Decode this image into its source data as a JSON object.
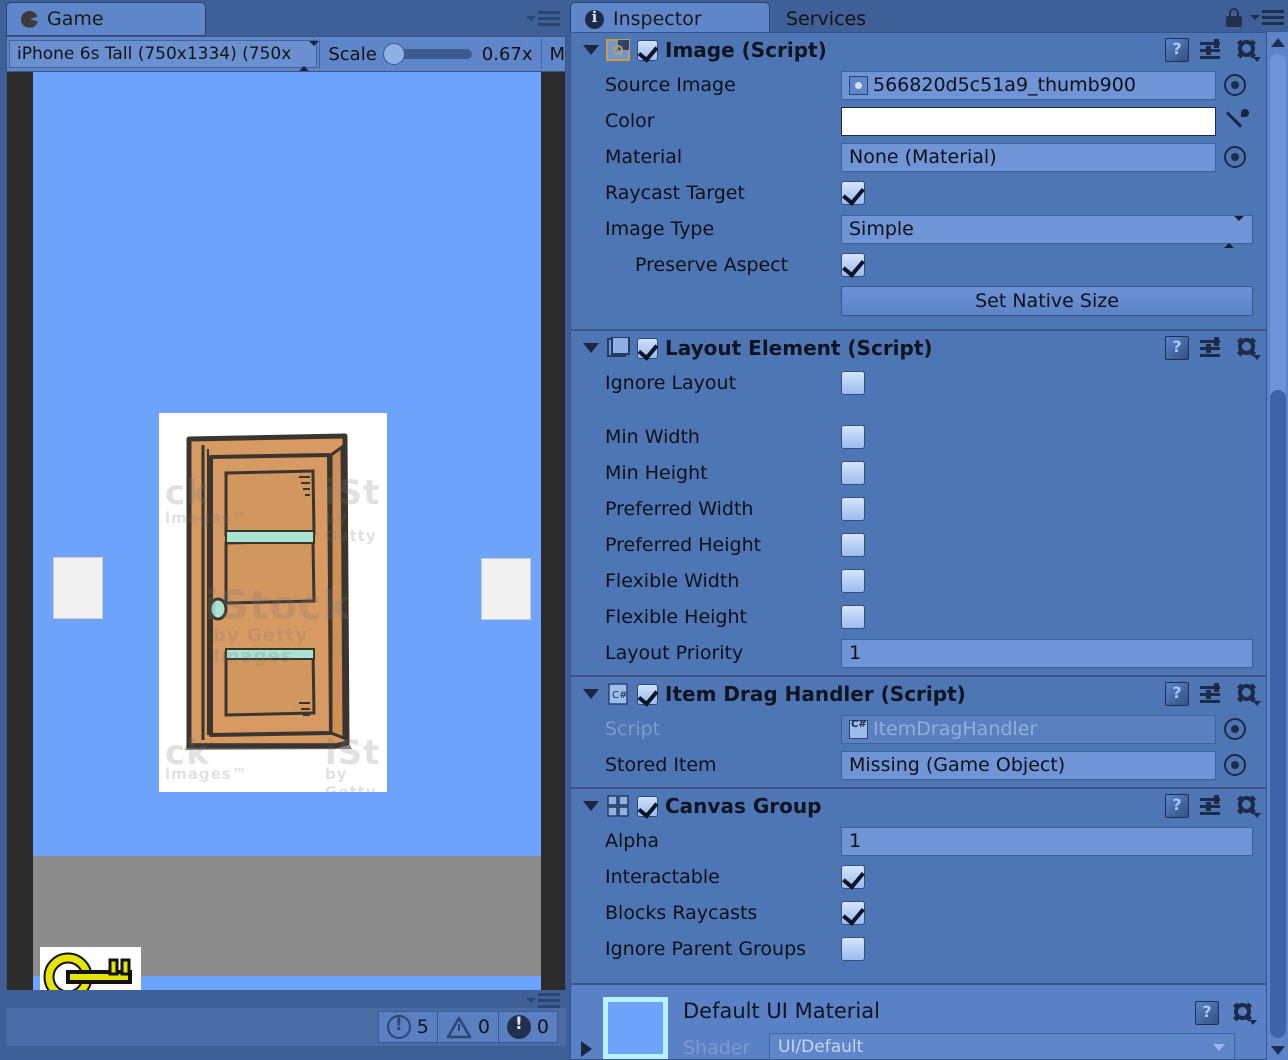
{
  "game": {
    "tab_label": "Game",
    "tab_icon": "unity-game-icon",
    "toolbar": {
      "device": "iPhone 6s Tall (750x1334) (750x",
      "scale_label": "Scale",
      "scale_value": "0.67x",
      "more_label": "M"
    },
    "scene": {
      "door_watermarks": [
        "ck",
        "images™",
        "iSt",
        "by Getty",
        "iStock",
        "by Getty Images",
        "ck",
        "iSt",
        "images™",
        "by Getty"
      ],
      "key_item_name": "key-item",
      "wall_panel_left": "wall-panel",
      "wall_panel_right": "wall-panel"
    },
    "console": {
      "info_count": "5",
      "warning_count": "0",
      "error_count": "0"
    }
  },
  "inspector": {
    "tabs": [
      {
        "label": "Inspector",
        "active": true
      },
      {
        "label": "Services",
        "active": false
      }
    ],
    "components": [
      {
        "id": "image-script",
        "title": "Image (Script)",
        "enabled": true,
        "expanded": true,
        "rows": [
          {
            "label": "Source Image",
            "type": "object",
            "value": "566820d5c51a9_thumb900"
          },
          {
            "label": "Color",
            "type": "color",
            "value": "#FFFFFF"
          },
          {
            "label": "Material",
            "type": "object",
            "value": "None (Material)"
          },
          {
            "label": "Raycast Target",
            "type": "checkbox",
            "value": true
          },
          {
            "label": "Image Type",
            "type": "popup",
            "value": "Simple"
          },
          {
            "label": "Preserve Aspect",
            "type": "checkbox",
            "value": true,
            "indent": true
          },
          {
            "label": "",
            "type": "button",
            "value": "Set Native Size"
          }
        ]
      },
      {
        "id": "layout-element",
        "title": "Layout Element (Script)",
        "enabled": true,
        "expanded": true,
        "rows": [
          {
            "label": "Ignore Layout",
            "type": "checkbox",
            "value": false
          },
          {
            "label": "",
            "type": "spacer"
          },
          {
            "label": "Min Width",
            "type": "checkbox",
            "value": false
          },
          {
            "label": "Min Height",
            "type": "checkbox",
            "value": false
          },
          {
            "label": "Preferred Width",
            "type": "checkbox",
            "value": false
          },
          {
            "label": "Preferred Height",
            "type": "checkbox",
            "value": false
          },
          {
            "label": "Flexible Width",
            "type": "checkbox",
            "value": false
          },
          {
            "label": "Flexible Height",
            "type": "checkbox",
            "value": false
          },
          {
            "label": "Layout Priority",
            "type": "text",
            "value": "1"
          }
        ]
      },
      {
        "id": "item-drag-handler",
        "title": "Item Drag Handler (Script)",
        "enabled": true,
        "expanded": true,
        "rows": [
          {
            "label": "Script",
            "type": "script",
            "value": "ItemDragHandler",
            "disabled": true
          },
          {
            "label": "Stored Item",
            "type": "object",
            "value": "Missing (Game Object)"
          }
        ]
      },
      {
        "id": "canvas-group",
        "title": "Canvas Group",
        "enabled": true,
        "expanded": true,
        "rows": [
          {
            "label": "Alpha",
            "type": "text",
            "value": "1"
          },
          {
            "label": "Interactable",
            "type": "checkbox",
            "value": true
          },
          {
            "label": "Blocks Raycasts",
            "type": "checkbox",
            "value": true
          },
          {
            "label": "Ignore Parent Groups",
            "type": "checkbox",
            "value": false
          }
        ]
      }
    ],
    "material_footer": {
      "title": "Default UI Material",
      "shader_label": "Shader",
      "shader_value": "UI/Default",
      "swatch_color": "#6EA3FB"
    }
  },
  "colors": {
    "panel_bg": "#3f6096",
    "inspector_bg": "#4f76b4",
    "field_bg": "#6f95d6",
    "tab_active": "#5f86c9",
    "sky": "#6EA3FB",
    "floor": "#8C8C8C",
    "door_wood": "#d79a62",
    "door_trim": "#a9e3d2",
    "key_gold": "#e4e400"
  }
}
